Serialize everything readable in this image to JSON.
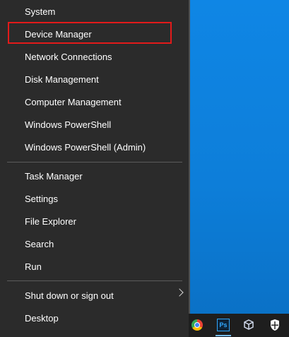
{
  "menu": {
    "items": [
      {
        "label": "System"
      },
      {
        "label": "Device Manager"
      },
      {
        "label": "Network Connections"
      },
      {
        "label": "Disk Management"
      },
      {
        "label": "Computer Management"
      },
      {
        "label": "Windows PowerShell"
      },
      {
        "label": "Windows PowerShell (Admin)"
      },
      {
        "label": "Task Manager"
      },
      {
        "label": "Settings"
      },
      {
        "label": "File Explorer"
      },
      {
        "label": "Search"
      },
      {
        "label": "Run"
      },
      {
        "label": "Shut down or sign out"
      },
      {
        "label": "Desktop"
      }
    ],
    "highlighted_item": "Device Manager"
  },
  "taskbar": {
    "ps_label": "Ps",
    "icons": [
      "chrome-icon",
      "photoshop-icon",
      "virtualbox-icon",
      "windows-security-icon"
    ]
  },
  "colors": {
    "menu_bg": "#2b2b2b",
    "desktop_bg": "#0d7ed8",
    "highlight_border": "#e31a1a",
    "taskbar_bg": "#1e1e1e"
  }
}
